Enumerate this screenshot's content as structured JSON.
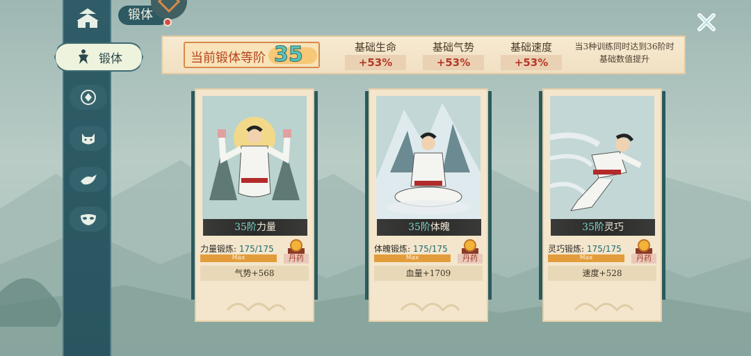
{
  "header": {
    "title": "锻体"
  },
  "sidebar": {
    "active_tab_label": "锻体",
    "icons": [
      "temple-icon",
      "martial-figure-icon",
      "emblem-icon",
      "cat-icon",
      "bird-icon",
      "mask-icon"
    ]
  },
  "banner": {
    "stage_label": "当前锻体等阶",
    "stage_value": "35",
    "stats": [
      {
        "name": "基础生命",
        "value": "+53%"
      },
      {
        "name": "基础气势",
        "value": "+53%"
      },
      {
        "name": "基础速度",
        "value": "+53%"
      }
    ],
    "note_line1": "当3种训练同时达到36阶时",
    "note_line2": "基础数值提升"
  },
  "cards": [
    {
      "level_prefix": "35阶",
      "level_name": "力量",
      "progress_label": "力量锻炼:",
      "progress_value": "175/175",
      "progress_fraction": 1.0,
      "max_label": "Max",
      "pill_label": "丹药",
      "bonus": "气势+568"
    },
    {
      "level_prefix": "35阶",
      "level_name": "体魄",
      "progress_label": "体魄锻炼:",
      "progress_value": "175/175",
      "progress_fraction": 1.0,
      "max_label": "Max",
      "pill_label": "丹药",
      "bonus": "血量+1709"
    },
    {
      "level_prefix": "35阶",
      "level_name": "灵巧",
      "progress_label": "灵巧锻炼:",
      "progress_value": "175/175",
      "progress_fraction": 1.0,
      "max_label": "Max",
      "pill_label": "丹药",
      "bonus": "速度+528"
    }
  ],
  "colors": {
    "accent_teal": "#2d5962",
    "stage_number": "#5ec4b7",
    "bonus_red": "#b43a2a"
  }
}
